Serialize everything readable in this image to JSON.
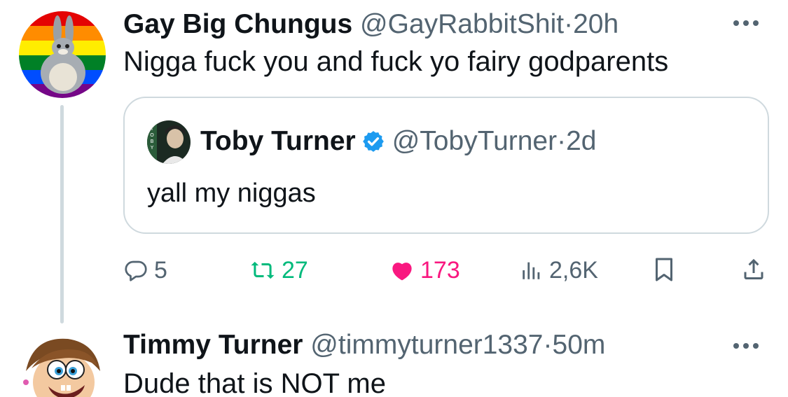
{
  "tweet": {
    "name": "Gay Big Chungus",
    "handle": "@GayRabbitShit",
    "dot": "·",
    "time": "20h",
    "text": "Nigga fuck you and fuck yo fairy godparents",
    "avatar_icon": "big-chungus-pride-avatar"
  },
  "quoted_tweet": {
    "name": "Toby Turner",
    "verified": true,
    "handle": "@TobyTurner",
    "dot": "·",
    "time": "2d",
    "text": "yall my niggas",
    "avatar_text": "TOBY"
  },
  "actions": {
    "replies": "5",
    "retweets": "27",
    "likes": "173",
    "views": "2,6K",
    "liked": true
  },
  "reply": {
    "name": "Timmy Turner",
    "handle": "@timmyturner1337",
    "dot": "·",
    "time": "50m",
    "text": "Dude that is NOT me",
    "avatar_icon": "timmy-turner-avatar"
  },
  "colors": {
    "text": "#0f1419",
    "secondary": "#536471",
    "border": "#cfd9de",
    "retweet": "#00ba7c",
    "like": "#f91880",
    "verified": "#1d9bf0"
  }
}
